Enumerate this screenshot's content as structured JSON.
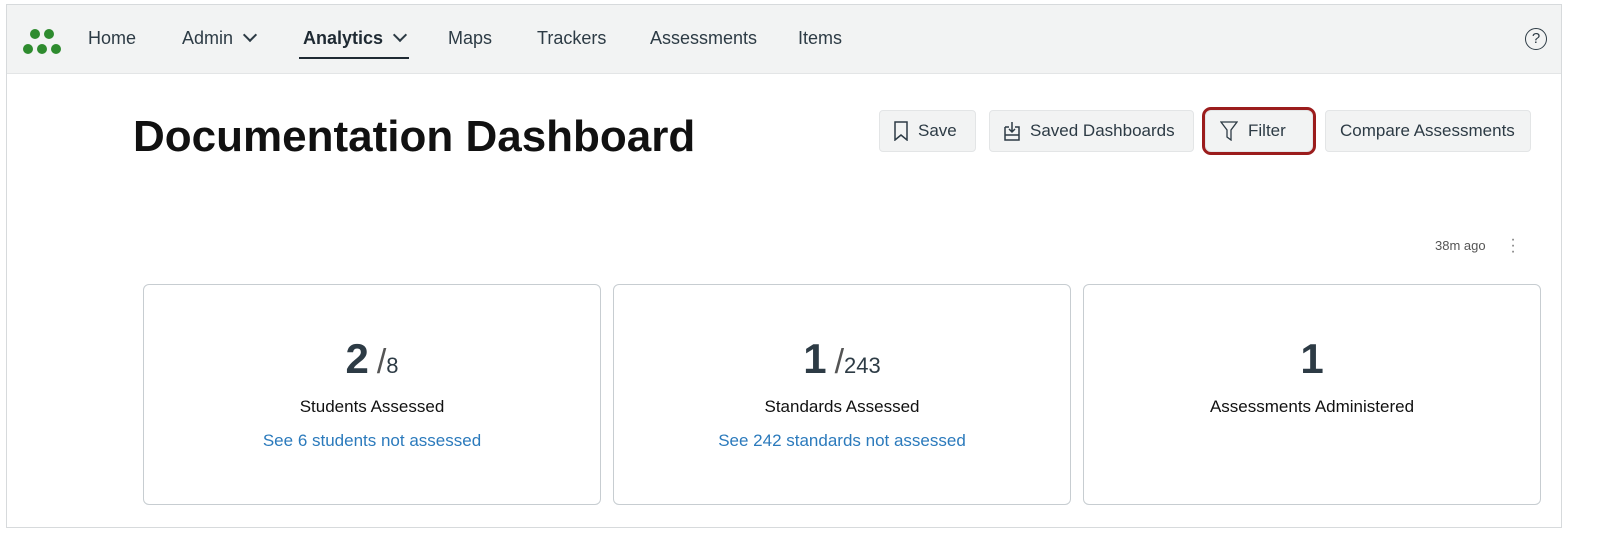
{
  "nav": {
    "items": [
      {
        "label": "Home"
      },
      {
        "label": "Admin"
      },
      {
        "label": "Analytics"
      },
      {
        "label": "Maps"
      },
      {
        "label": "Trackers"
      },
      {
        "label": "Assessments"
      },
      {
        "label": "Items"
      }
    ],
    "help": "?"
  },
  "page": {
    "title": "Documentation Dashboard"
  },
  "toolbar": {
    "save": "Save",
    "saved_dashboards": "Saved Dashboards",
    "filter": "Filter",
    "compare": "Compare Assessments"
  },
  "status": {
    "updated": "38m ago"
  },
  "cards": [
    {
      "value": "2",
      "total": "8",
      "label": "Students Assessed",
      "link": "See 6 students not assessed"
    },
    {
      "value": "1",
      "total": "243",
      "label": "Standards Assessed",
      "link": "See 242 standards not assessed"
    },
    {
      "value": "1",
      "label": "Assessments Administered"
    }
  ],
  "colors": {
    "accent": "#2b7abc",
    "brand": "#2e8b2e",
    "highlight": "#9b1c1c"
  }
}
